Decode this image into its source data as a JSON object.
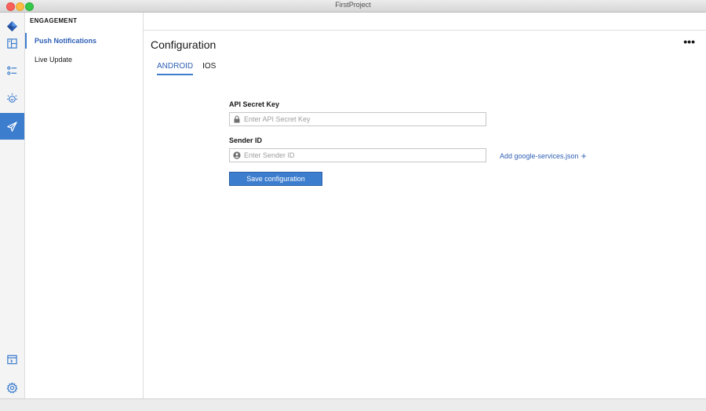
{
  "window": {
    "title": "FirstProject"
  },
  "rail": {
    "items": [
      {
        "icon": "logo-icon"
      },
      {
        "icon": "dashboard-icon"
      },
      {
        "icon": "settings-list-icon"
      },
      {
        "icon": "bulb-icon"
      },
      {
        "icon": "paper-plane-icon",
        "active": true
      },
      {
        "icon": "terminal-icon"
      },
      {
        "icon": "gear-icon"
      }
    ],
    "accent": "#3c7dce"
  },
  "subnav": {
    "heading": "ENGAGEMENT",
    "items": [
      {
        "label": "Push Notifications",
        "active": true
      },
      {
        "label": "Live Update"
      }
    ]
  },
  "main": {
    "title": "Configuration",
    "overflow_label": "•••",
    "tabs": [
      {
        "label": "ANDROID",
        "active": true
      },
      {
        "label": "IOS"
      }
    ],
    "form": {
      "api_secret_key": {
        "label": "API Secret Key",
        "placeholder": "Enter API Secret Key",
        "value": ""
      },
      "sender_id": {
        "label": "Sender ID",
        "placeholder": "Enter Sender ID",
        "value": ""
      },
      "add_link": "Add google-services.json",
      "add_link_plus": "+",
      "save_label": "Save configuration"
    }
  }
}
